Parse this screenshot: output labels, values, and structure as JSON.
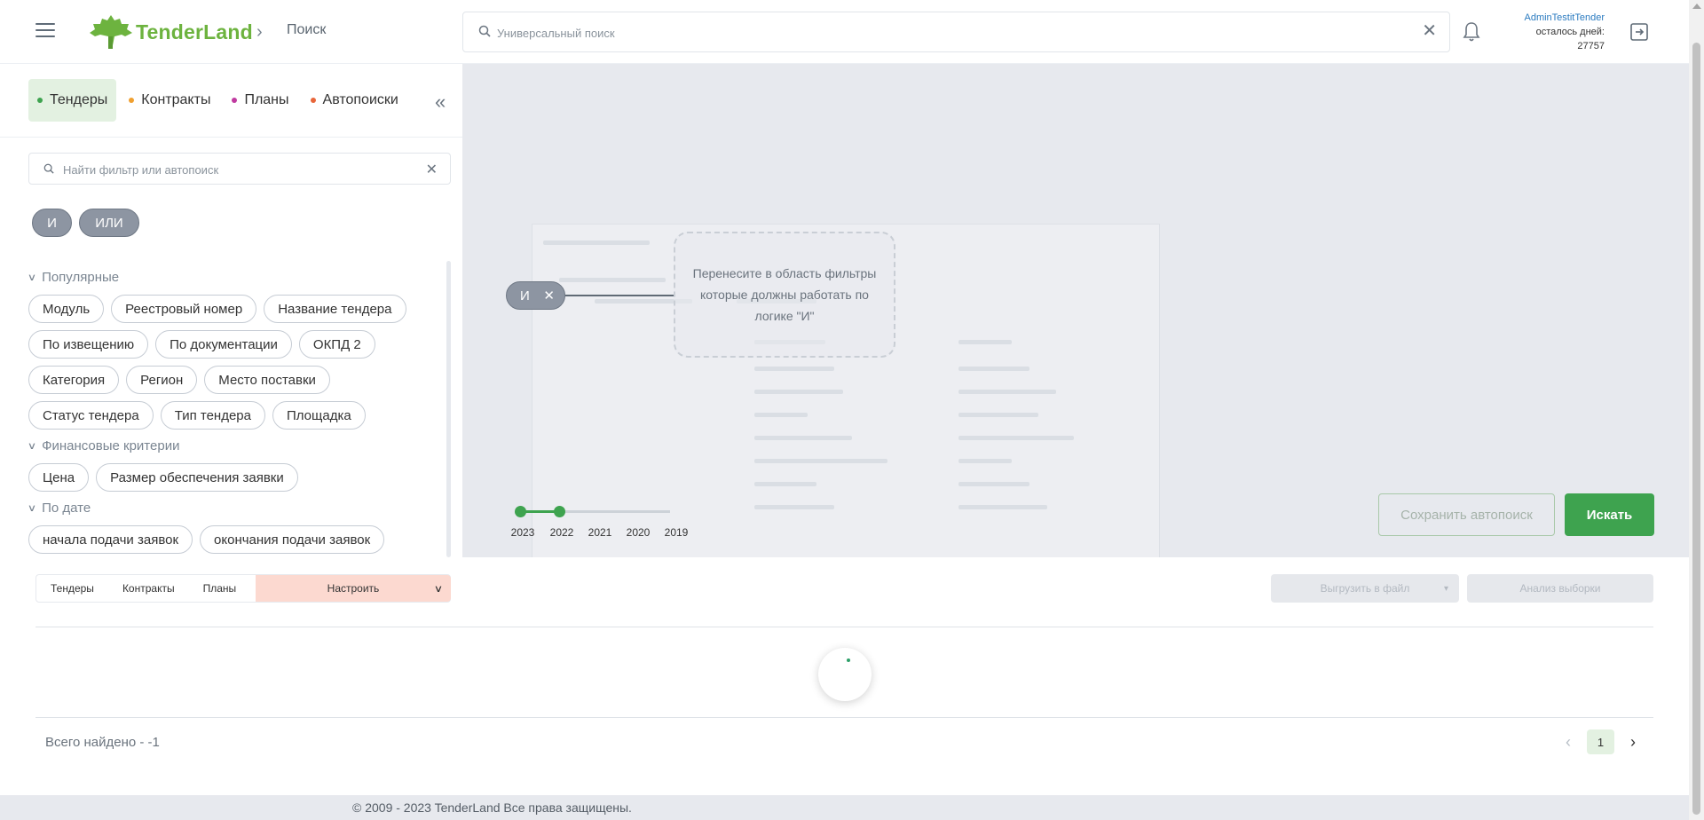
{
  "header": {
    "logo_text": "TenderLand",
    "breadcrumb": "Поиск",
    "search_placeholder": "Универсальный поиск",
    "user_name": "AdminTestitTender",
    "days_label": "осталось дней:",
    "days_value": "27757"
  },
  "sidebar": {
    "tabs": [
      {
        "label": "Тендеры",
        "color": "#3ea34f"
      },
      {
        "label": "Контракты",
        "color": "#f0a030"
      },
      {
        "label": "Планы",
        "color": "#c03aa0"
      },
      {
        "label": "Автопоиски",
        "color": "#e8663a"
      }
    ],
    "filter_placeholder": "Найти фильтр или автопоиск",
    "logic": {
      "and": "И",
      "or": "ИЛИ"
    },
    "sections": [
      {
        "title": "Популярные",
        "chips": [
          "Модуль",
          "Реестровый номер",
          "Название тендера",
          "По извещению",
          "По документации",
          "ОКПД 2",
          "Категория",
          "Регион",
          "Место поставки",
          "Статус тендера",
          "Тип тендера",
          "Площадка"
        ]
      },
      {
        "title": "Финансовые критерии",
        "chips": [
          "Цена",
          "Размер обеспечения заявки"
        ]
      },
      {
        "title": "По дате",
        "chips": [
          "начала подачи заявок",
          "окончания подачи заявок"
        ]
      }
    ]
  },
  "workarea": {
    "node_label": "И",
    "dropzone_text": "Перенесите в область фильтры которые должны работать по логике \"И\"",
    "timeline": [
      "2023",
      "2022",
      "2021",
      "2020",
      "2019"
    ],
    "save_autosearch": "Сохранить автопоиск",
    "search": "Искать"
  },
  "results": {
    "tabs": [
      "Тендеры",
      "Контракты",
      "Планы"
    ],
    "configure": "Настроить",
    "export": "Выгрузить в файл",
    "analysis": "Анализ выборки",
    "total": "Всего найдено - -1",
    "page": "1"
  },
  "footer": {
    "copyright": "© 2009 - 2023 TenderLand Все права защищены."
  },
  "colors": {
    "accent": "#3ea34f",
    "logo": "#6db33f",
    "link": "#2b7bc0"
  }
}
